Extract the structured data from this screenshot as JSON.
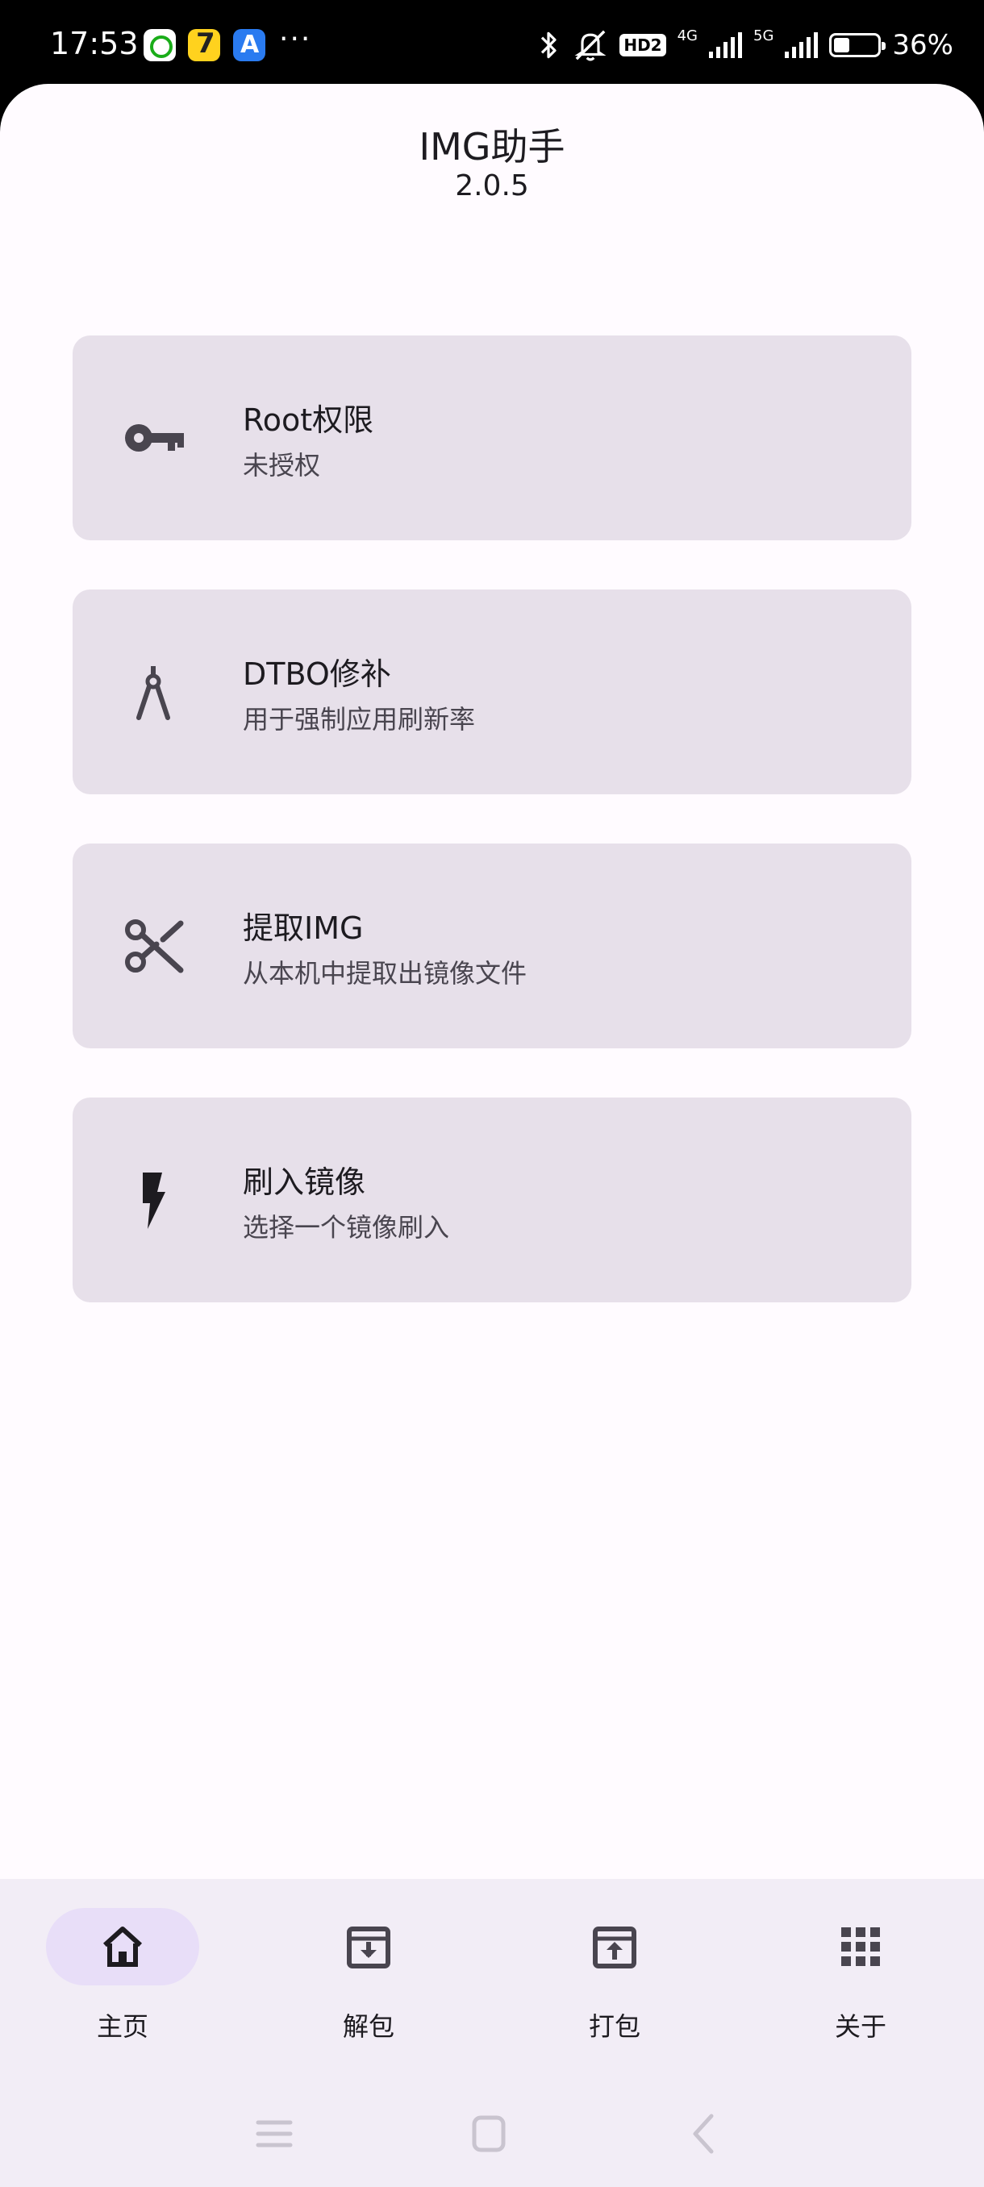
{
  "status_bar": {
    "time": "17:53",
    "more": "···",
    "hd_badge": "HD2",
    "net_4g": "4G",
    "net_5g": "5G",
    "battery_percent": "36%"
  },
  "app": {
    "title": "IMG助手",
    "version": "2.0.5"
  },
  "cards": [
    {
      "title": "Root权限",
      "subtitle": "未授权",
      "icon": "key-icon"
    },
    {
      "title": "DTBO修补",
      "subtitle": "用于强制应用刷新率",
      "icon": "compass-tool-icon"
    },
    {
      "title": "提取IMG",
      "subtitle": "从本机中提取出镜像文件",
      "icon": "scissors-icon"
    },
    {
      "title": "刷入镜像",
      "subtitle": "选择一个镜像刷入",
      "icon": "flash-icon"
    }
  ],
  "bottom_nav": {
    "items": [
      {
        "label": "主页",
        "icon": "home-icon",
        "active": true
      },
      {
        "label": "解包",
        "icon": "unpack-icon",
        "active": false
      },
      {
        "label": "打包",
        "icon": "pack-icon",
        "active": false
      },
      {
        "label": "关于",
        "icon": "apps-grid-icon",
        "active": false
      }
    ]
  },
  "colors": {
    "background": "#fffbff",
    "card": "#e7e0ea",
    "nav_background": "#f2edf6",
    "nav_active_pill": "#e8def8",
    "icon": "#49454f"
  }
}
